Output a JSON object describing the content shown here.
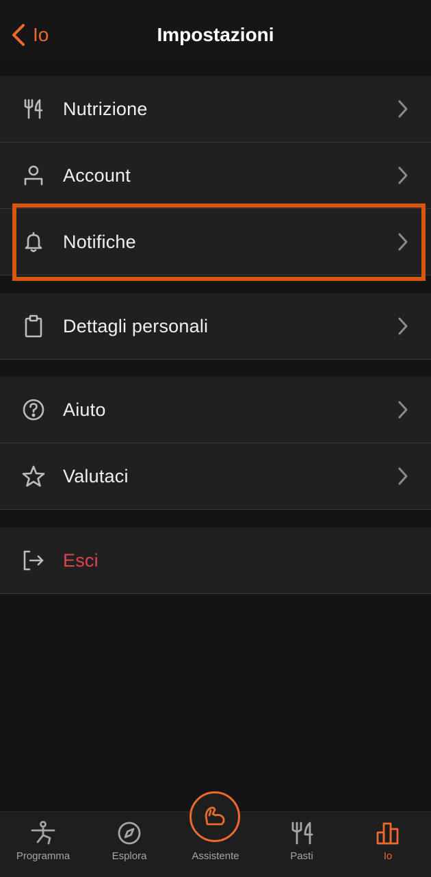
{
  "header": {
    "back_label": "Io",
    "title": "Impostazioni"
  },
  "settings": {
    "group1": [
      {
        "label": "Nutrizione",
        "icon": "fork-knife-icon"
      },
      {
        "label": "Account",
        "icon": "user-icon"
      },
      {
        "label": "Notifiche",
        "icon": "bell-icon"
      }
    ],
    "group2": [
      {
        "label": "Dettagli personali",
        "icon": "clipboard-icon"
      }
    ],
    "group3": [
      {
        "label": "Aiuto",
        "icon": "question-icon"
      },
      {
        "label": "Valutaci",
        "icon": "star-icon"
      }
    ],
    "group4": [
      {
        "label": "Esci",
        "icon": "logout-icon"
      }
    ]
  },
  "tabs": [
    {
      "label": "Programma",
      "icon": "yoga-pose-icon"
    },
    {
      "label": "Esplora",
      "icon": "compass-icon"
    },
    {
      "label": "Assistente",
      "icon": "flexed-arm-icon"
    },
    {
      "label": "Pasti",
      "icon": "fork-knife-icon"
    },
    {
      "label": "Io",
      "icon": "bar-chart-icon",
      "active": true
    }
  ],
  "colors": {
    "accent": "#ee6a2c",
    "danger": "#e0424e",
    "background": "#141414",
    "row_background": "#202020",
    "highlight": "#d9560f"
  }
}
